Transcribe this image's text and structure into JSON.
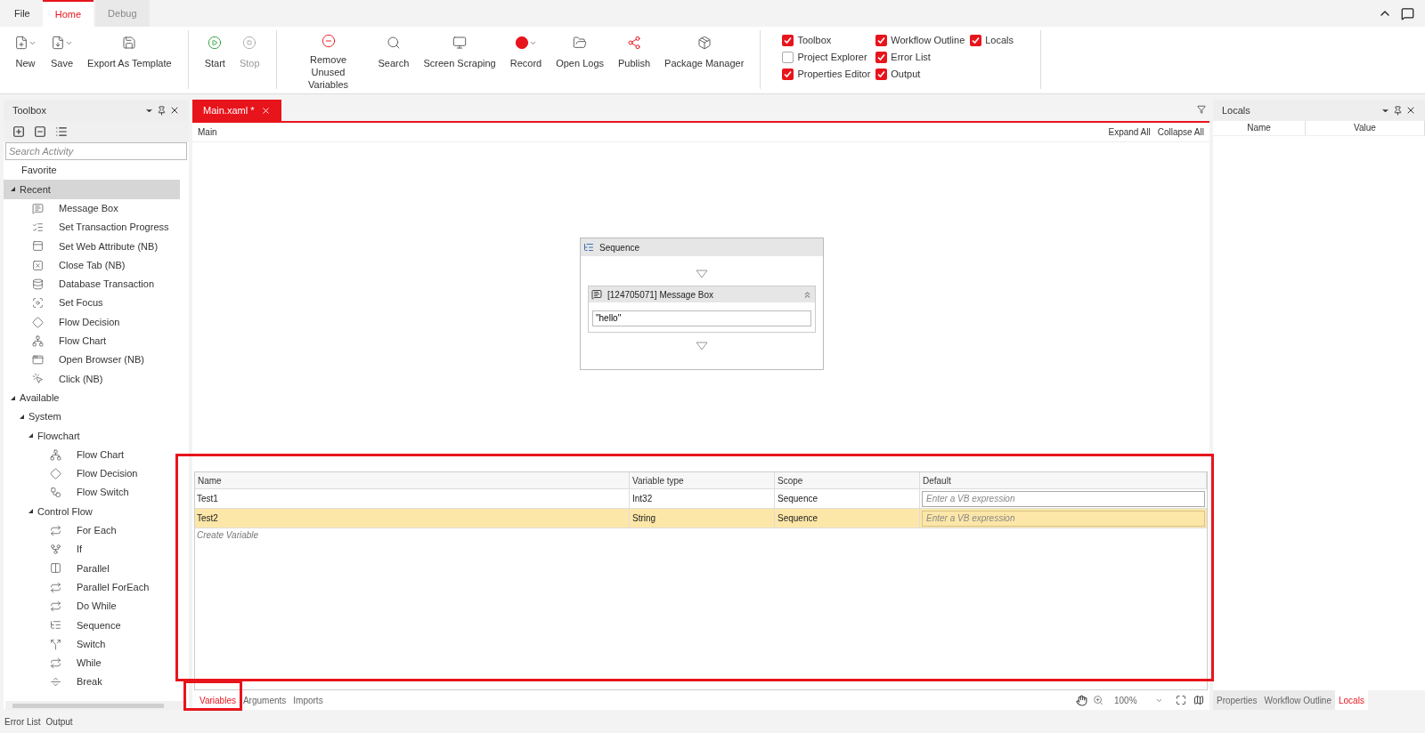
{
  "menu_tabs": [
    {
      "label": "File",
      "selected": false
    },
    {
      "label": "Home",
      "selected": true
    },
    {
      "label": "Debug",
      "selected": false
    }
  ],
  "ribbon": {
    "groups": [
      [
        {
          "kind": "new",
          "label": "New",
          "dropdown": true,
          "disabled": false
        },
        {
          "kind": "save",
          "label": "Save",
          "dropdown": true,
          "disabled": false
        },
        {
          "kind": "template",
          "label": "Export As Template",
          "dropdown": false,
          "disabled": false
        }
      ],
      [
        {
          "kind": "start",
          "label": "Start",
          "dropdown": false,
          "disabled": false
        },
        {
          "kind": "stop",
          "label": "Stop",
          "dropdown": false,
          "disabled": true
        }
      ],
      [
        {
          "kind": "remove",
          "label": "Remove Unused Variables",
          "dropdown": false,
          "disabled": false
        },
        {
          "kind": "search",
          "label": "Search",
          "dropdown": false,
          "disabled": false
        },
        {
          "kind": "screen",
          "label": "Screen Scraping",
          "dropdown": false,
          "disabled": false
        },
        {
          "kind": "record",
          "label": "Record",
          "dropdown": true,
          "disabled": false
        },
        {
          "kind": "logs",
          "label": "Open Logs",
          "dropdown": false,
          "disabled": false
        },
        {
          "kind": "publish",
          "label": "Publish",
          "dropdown": false,
          "disabled": false
        },
        {
          "kind": "package",
          "label": "Package Manager",
          "dropdown": false,
          "disabled": false
        }
      ]
    ],
    "panels": [
      [
        {
          "label": "Toolbox",
          "checked": true
        },
        {
          "label": "Workflow Outline",
          "checked": true
        },
        {
          "label": "Locals",
          "checked": true
        }
      ],
      [
        {
          "label": "Project Explorer",
          "checked": false
        },
        {
          "label": "Error List",
          "checked": true
        }
      ],
      [
        {
          "label": "Properties Editor",
          "checked": true
        },
        {
          "label": "Output",
          "checked": true
        }
      ]
    ]
  },
  "toolbox": {
    "title": "Toolbox",
    "search": {
      "placeholder": "Search Activity"
    },
    "tree": [
      {
        "label": "Favorite",
        "selected": false
      },
      {
        "label": "Recent",
        "expanded": true,
        "selected": true,
        "children": [
          {
            "label": "Message Box",
            "kind": "message"
          },
          {
            "label": "Set Transaction Progress",
            "kind": "progress"
          },
          {
            "label": "Set Web Attribute (NB)",
            "kind": "web"
          },
          {
            "label": "Close Tab (NB)",
            "kind": "closetab"
          },
          {
            "label": "Database Transaction",
            "kind": "database"
          },
          {
            "label": "Set Focus",
            "kind": "focus"
          },
          {
            "label": "Flow Decision",
            "kind": "decision"
          },
          {
            "label": "Flow Chart",
            "kind": "chart"
          },
          {
            "label": "Open Browser (NB)",
            "kind": "browser"
          },
          {
            "label": "Click (NB)",
            "kind": "click"
          }
        ]
      },
      {
        "label": "Available",
        "expanded": true,
        "selected": false,
        "children": [
          {
            "label": "System",
            "expanded": true,
            "children": [
              {
                "label": "Flowchart",
                "expanded": true,
                "children": [
                  {
                    "label": "Flow Chart",
                    "kind": "chart"
                  },
                  {
                    "label": "Flow Decision",
                    "kind": "decision"
                  },
                  {
                    "label": "Flow Switch",
                    "kind": "switchflow"
                  }
                ]
              },
              {
                "label": "Control Flow",
                "expanded": true,
                "children": [
                  {
                    "label": "For Each",
                    "kind": "loop"
                  },
                  {
                    "label": "If",
                    "kind": "if"
                  },
                  {
                    "label": "Parallel",
                    "kind": "parallel"
                  },
                  {
                    "label": "Parallel ForEach",
                    "kind": "loop"
                  },
                  {
                    "label": "Do While",
                    "kind": "loop"
                  },
                  {
                    "label": "Sequence",
                    "kind": "sequence"
                  },
                  {
                    "label": "Switch",
                    "kind": "switch"
                  },
                  {
                    "label": "While",
                    "kind": "loop"
                  },
                  {
                    "label": "Break",
                    "kind": "break"
                  }
                ]
              }
            ]
          }
        ]
      }
    ]
  },
  "document_tab": {
    "label": "Main.xaml *",
    "selected": true
  },
  "breadcrumb": "Main",
  "designer_actions": [
    "Expand All",
    "Collapse All"
  ],
  "sequence": {
    "title": "Sequence",
    "activity": {
      "title": "[124705071] Message Box",
      "value": "\"hello\""
    }
  },
  "variables": {
    "columns": [
      "Name",
      "Variable type",
      "Scope",
      "Default"
    ],
    "rows": [
      {
        "name": "Test1",
        "type": "Int32",
        "scope": "Sequence",
        "default_placeholder": "Enter a VB expression",
        "selected": false
      },
      {
        "name": "Test2",
        "type": "String",
        "scope": "Sequence",
        "default_placeholder": "Enter a VB expression",
        "selected": true
      }
    ],
    "create_placeholder": "Create Variable",
    "highlighted": true
  },
  "designer_tabs": [
    {
      "label": "Variables",
      "selected": true,
      "highlighted": true
    },
    {
      "label": "Arguments",
      "selected": false,
      "highlighted": false
    },
    {
      "label": "Imports",
      "selected": false,
      "highlighted": false
    }
  ],
  "zoom": "100%",
  "locals": {
    "title": "Locals",
    "columns": [
      "Name",
      "Value"
    ]
  },
  "right_tabs": [
    {
      "label": "Properties",
      "selected": false
    },
    {
      "label": "Workflow Outline",
      "selected": false
    },
    {
      "label": "Locals",
      "selected": true
    }
  ],
  "bottom_tabs": [
    "Error List",
    "Output"
  ]
}
